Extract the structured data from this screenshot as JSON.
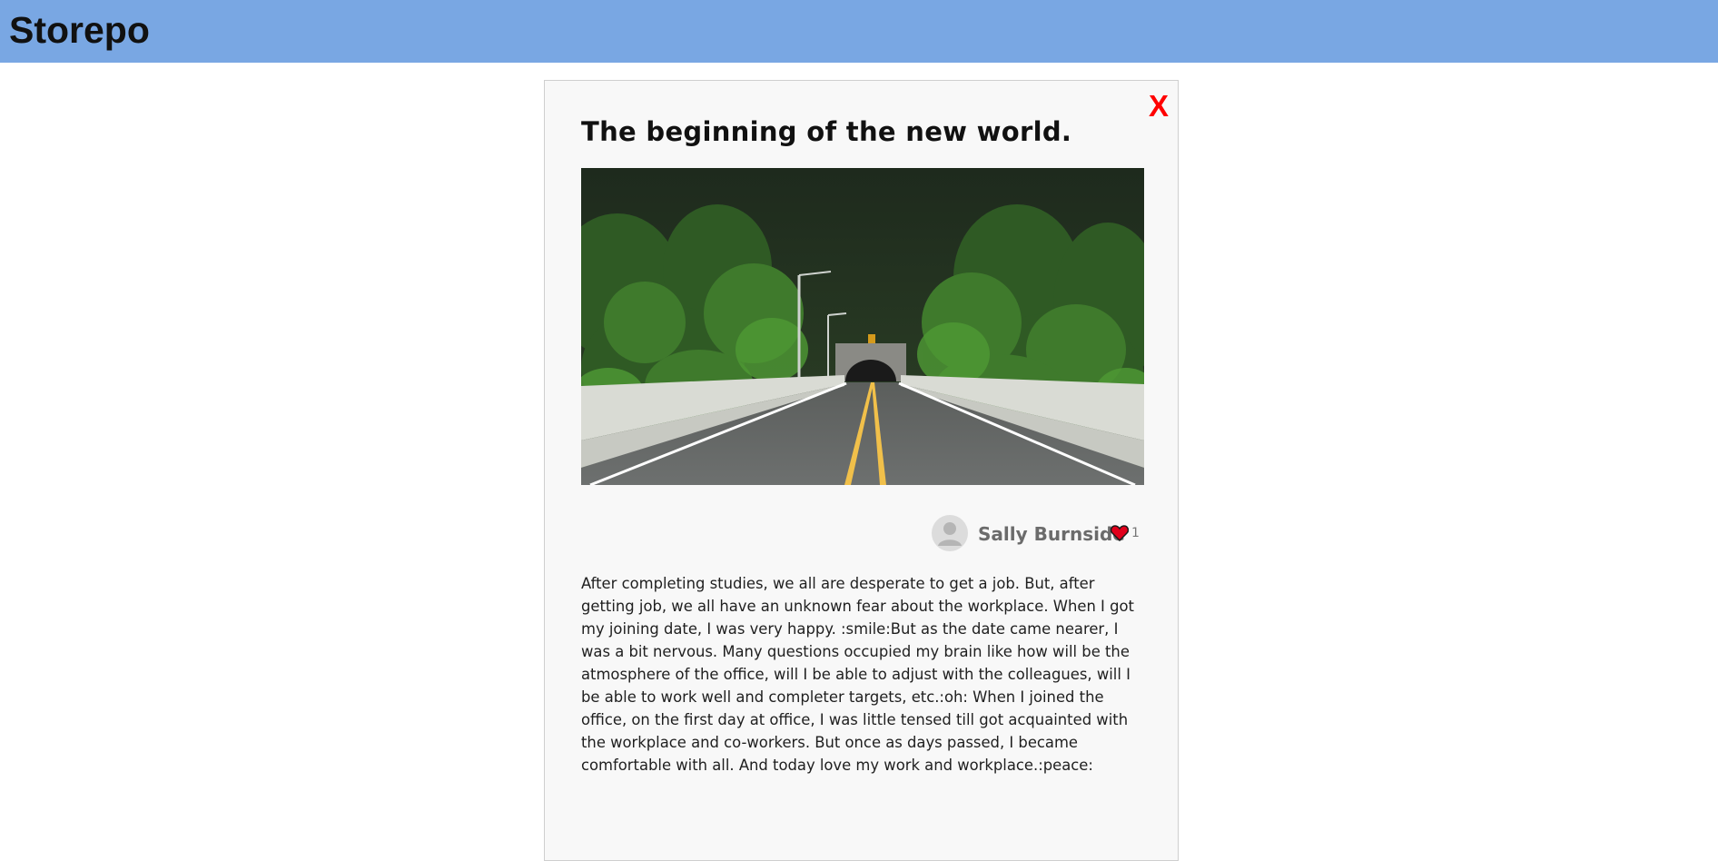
{
  "app": {
    "brand": "Storepo"
  },
  "story": {
    "close_label": "X",
    "title": "The beginning of the new world.",
    "image_alt": "Road leading into a tunnel through a forest",
    "author": {
      "name": "Sally Burnside"
    },
    "likes": "1",
    "body": "After completing studies, we all are desperate to get a job. But, after getting job, we all have an unknown fear about the workplace. When I got my joining date, I was very happy. :smile:But as the date came nearer, I was a bit nervous. Many questions occupied my brain like how will be the atmosphere of the office, will I be able to adjust with the colleagues, will I be able to work well and completer targets, etc.:oh: When I joined the office, on the first day at office, I was little tensed till got acquainted with the workplace and co-workers. But once as days passed, I became comfortable with all. And today love my work and workplace.:peace:"
  },
  "colors": {
    "header": "#79a7e3",
    "close": "#ff0000",
    "heart": "#e0001b"
  },
  "icons": {
    "close": "close-icon",
    "avatar": "user-avatar-icon",
    "like": "heart-icon"
  }
}
